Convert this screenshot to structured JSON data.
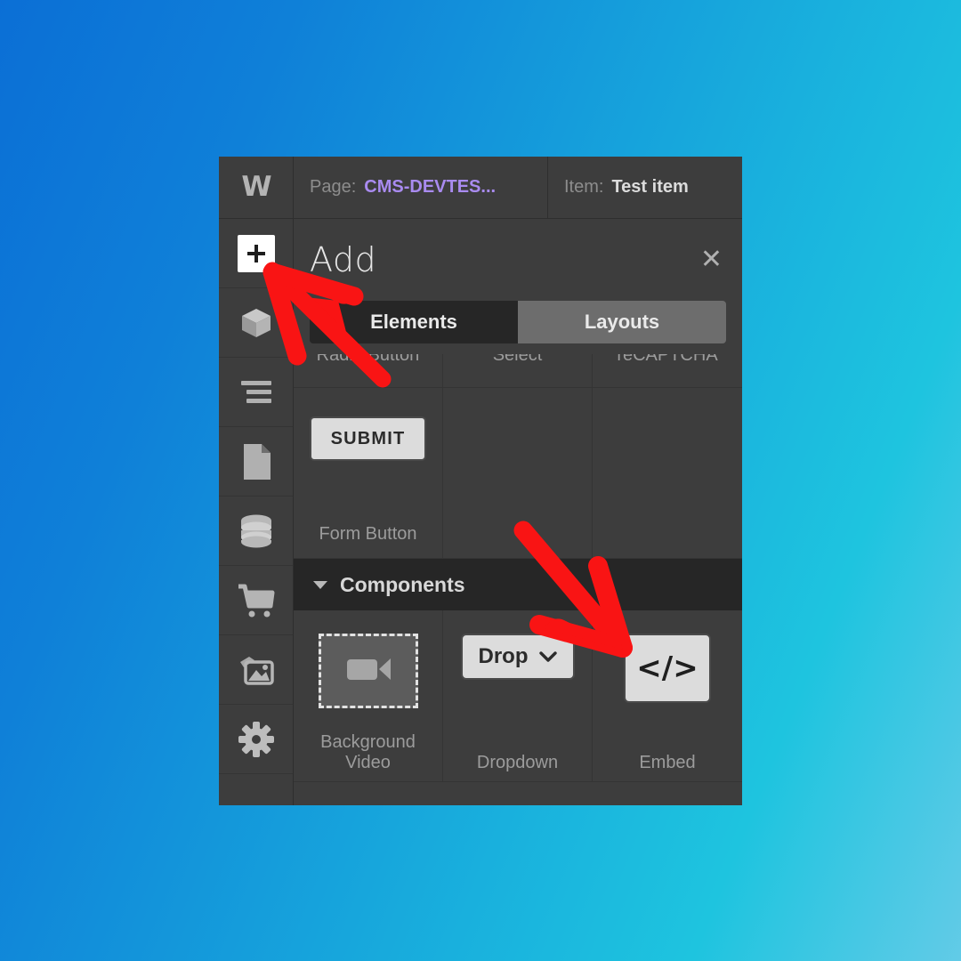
{
  "background": {
    "gradient_from": "#0b6fd6",
    "gradient_to": "#62cbe7"
  },
  "window": {
    "app": "Webflow Designer",
    "topbar": {
      "logo": "W",
      "page_label": "Page:",
      "page_value": "CMS-DEVTES...",
      "page_value_color": "#a98bf0",
      "item_label": "Item:",
      "item_value": "Test item"
    },
    "sidebar": {
      "items": [
        {
          "name": "add",
          "icon": "plus-icon",
          "active": true
        },
        {
          "name": "components",
          "icon": "box-icon",
          "active": false
        },
        {
          "name": "navigator",
          "icon": "navigator-icon",
          "active": false
        },
        {
          "name": "pages",
          "icon": "page-icon",
          "active": false
        },
        {
          "name": "cms",
          "icon": "database-icon",
          "active": false
        },
        {
          "name": "ecommerce",
          "icon": "cart-icon",
          "active": false
        },
        {
          "name": "assets",
          "icon": "images-icon",
          "active": false
        },
        {
          "name": "settings",
          "icon": "gear-icon",
          "active": false
        }
      ]
    },
    "add_panel": {
      "title": "Add",
      "close_icon": "close-icon",
      "tabs": [
        {
          "label": "Elements",
          "active": true
        },
        {
          "label": "Layouts",
          "active": false
        }
      ],
      "forms_row_partial": [
        {
          "label": "Radio Button"
        },
        {
          "label": "Select"
        },
        {
          "label": "reCAPTCHA"
        }
      ],
      "forms_row": [
        {
          "label": "Form Button",
          "widget": "SUBMIT"
        },
        {
          "label": "",
          "widget": ""
        },
        {
          "label": "",
          "widget": ""
        }
      ],
      "components_section": {
        "title": "Components",
        "expanded": true,
        "chevron_icon": "chevron-down-icon",
        "items": [
          {
            "label": "Background Video",
            "icon": "video-camera-icon"
          },
          {
            "label": "Dropdown",
            "widget_text": "Drop",
            "icon": "chevron-down-icon"
          },
          {
            "label": "Embed",
            "widget_text": "</>",
            "icon": "code-icon"
          }
        ]
      }
    }
  },
  "annotations": {
    "arrow_color": "#f91414",
    "arrows": [
      {
        "name": "arrow-to-add-button",
        "points_to": "add-sidebar-button"
      },
      {
        "name": "arrow-to-embed",
        "points_to": "embed-component"
      }
    ]
  }
}
